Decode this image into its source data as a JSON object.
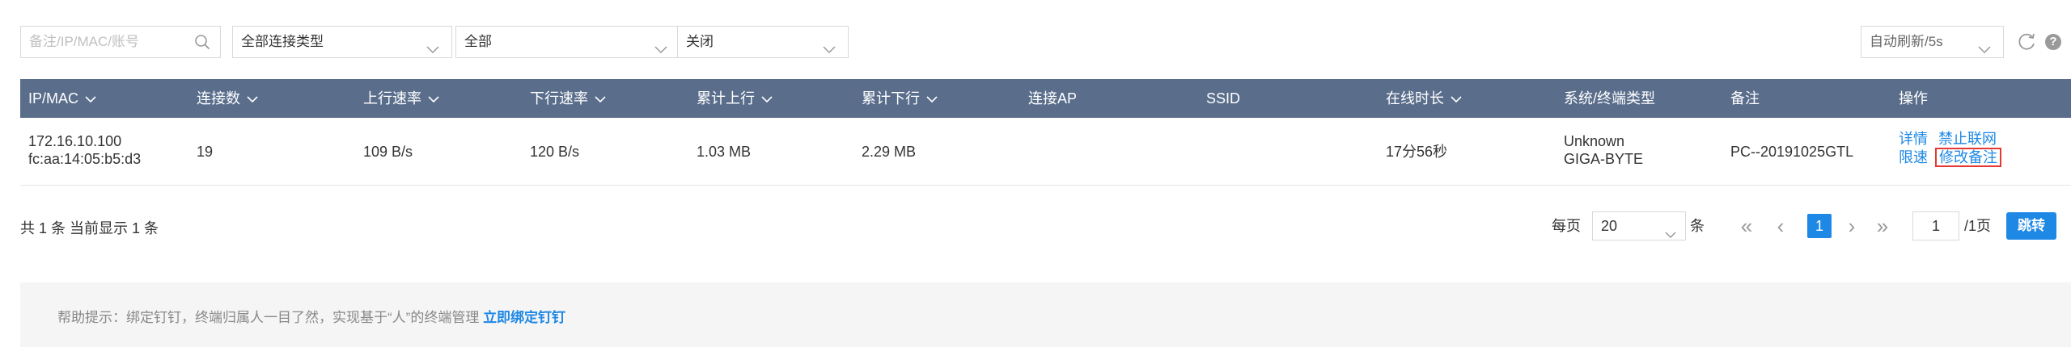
{
  "filters": {
    "search_placeholder": "备注/IP/MAC/账号",
    "connection_type": "全部连接类型",
    "scope": "全部",
    "state": "关闭",
    "auto_refresh": "自动刷新/5s"
  },
  "icons": {
    "search": "search-icon",
    "refresh": "refresh-icon",
    "help": "help-icon",
    "dropdown": "chevron-down-icon"
  },
  "colors": {
    "header_bg": "#5a6e8c",
    "link": "#1e88e5",
    "highlight_border": "#e53935",
    "active_page": "#1e88e5"
  },
  "table": {
    "headers": [
      "IP/MAC",
      "连接数",
      "上行速率",
      "下行速率",
      "累计上行",
      "累计下行",
      "连接AP",
      "SSID",
      "在线时长",
      "系统/终端类型",
      "备注",
      "操作"
    ],
    "rows": [
      {
        "ip": "172.16.10.100",
        "mac": "fc:aa:14:05:b5:d3",
        "connections": "19",
        "up_rate": "109 B/s",
        "down_rate": "120 B/s",
        "total_up": "1.03 MB",
        "total_down": "2.29 MB",
        "ap": "",
        "ssid": "",
        "online": "17分56秒",
        "system": "Unknown",
        "vendor": "GIGA-BYTE",
        "note": "PC--20191025GTL",
        "actions": {
          "detail": "详情",
          "block": "禁止联网",
          "limit": "限速",
          "edit_note": "修改备注"
        }
      }
    ]
  },
  "footer": {
    "summary": "共 1 条 当前显示 1 条",
    "per_page_label": "每页",
    "per_page_value": "20",
    "per_page_unit": "条",
    "first": "«",
    "prev": "‹",
    "current_page": "1",
    "next": "›",
    "last": "»",
    "goto_value": "1",
    "total_pages": "/1页",
    "goto_button": "跳转"
  },
  "tip": {
    "text": "帮助提示：绑定钉钉，终端归属人一目了然，实现基于“人”的终端管理",
    "link": "立即绑定钉钉"
  }
}
